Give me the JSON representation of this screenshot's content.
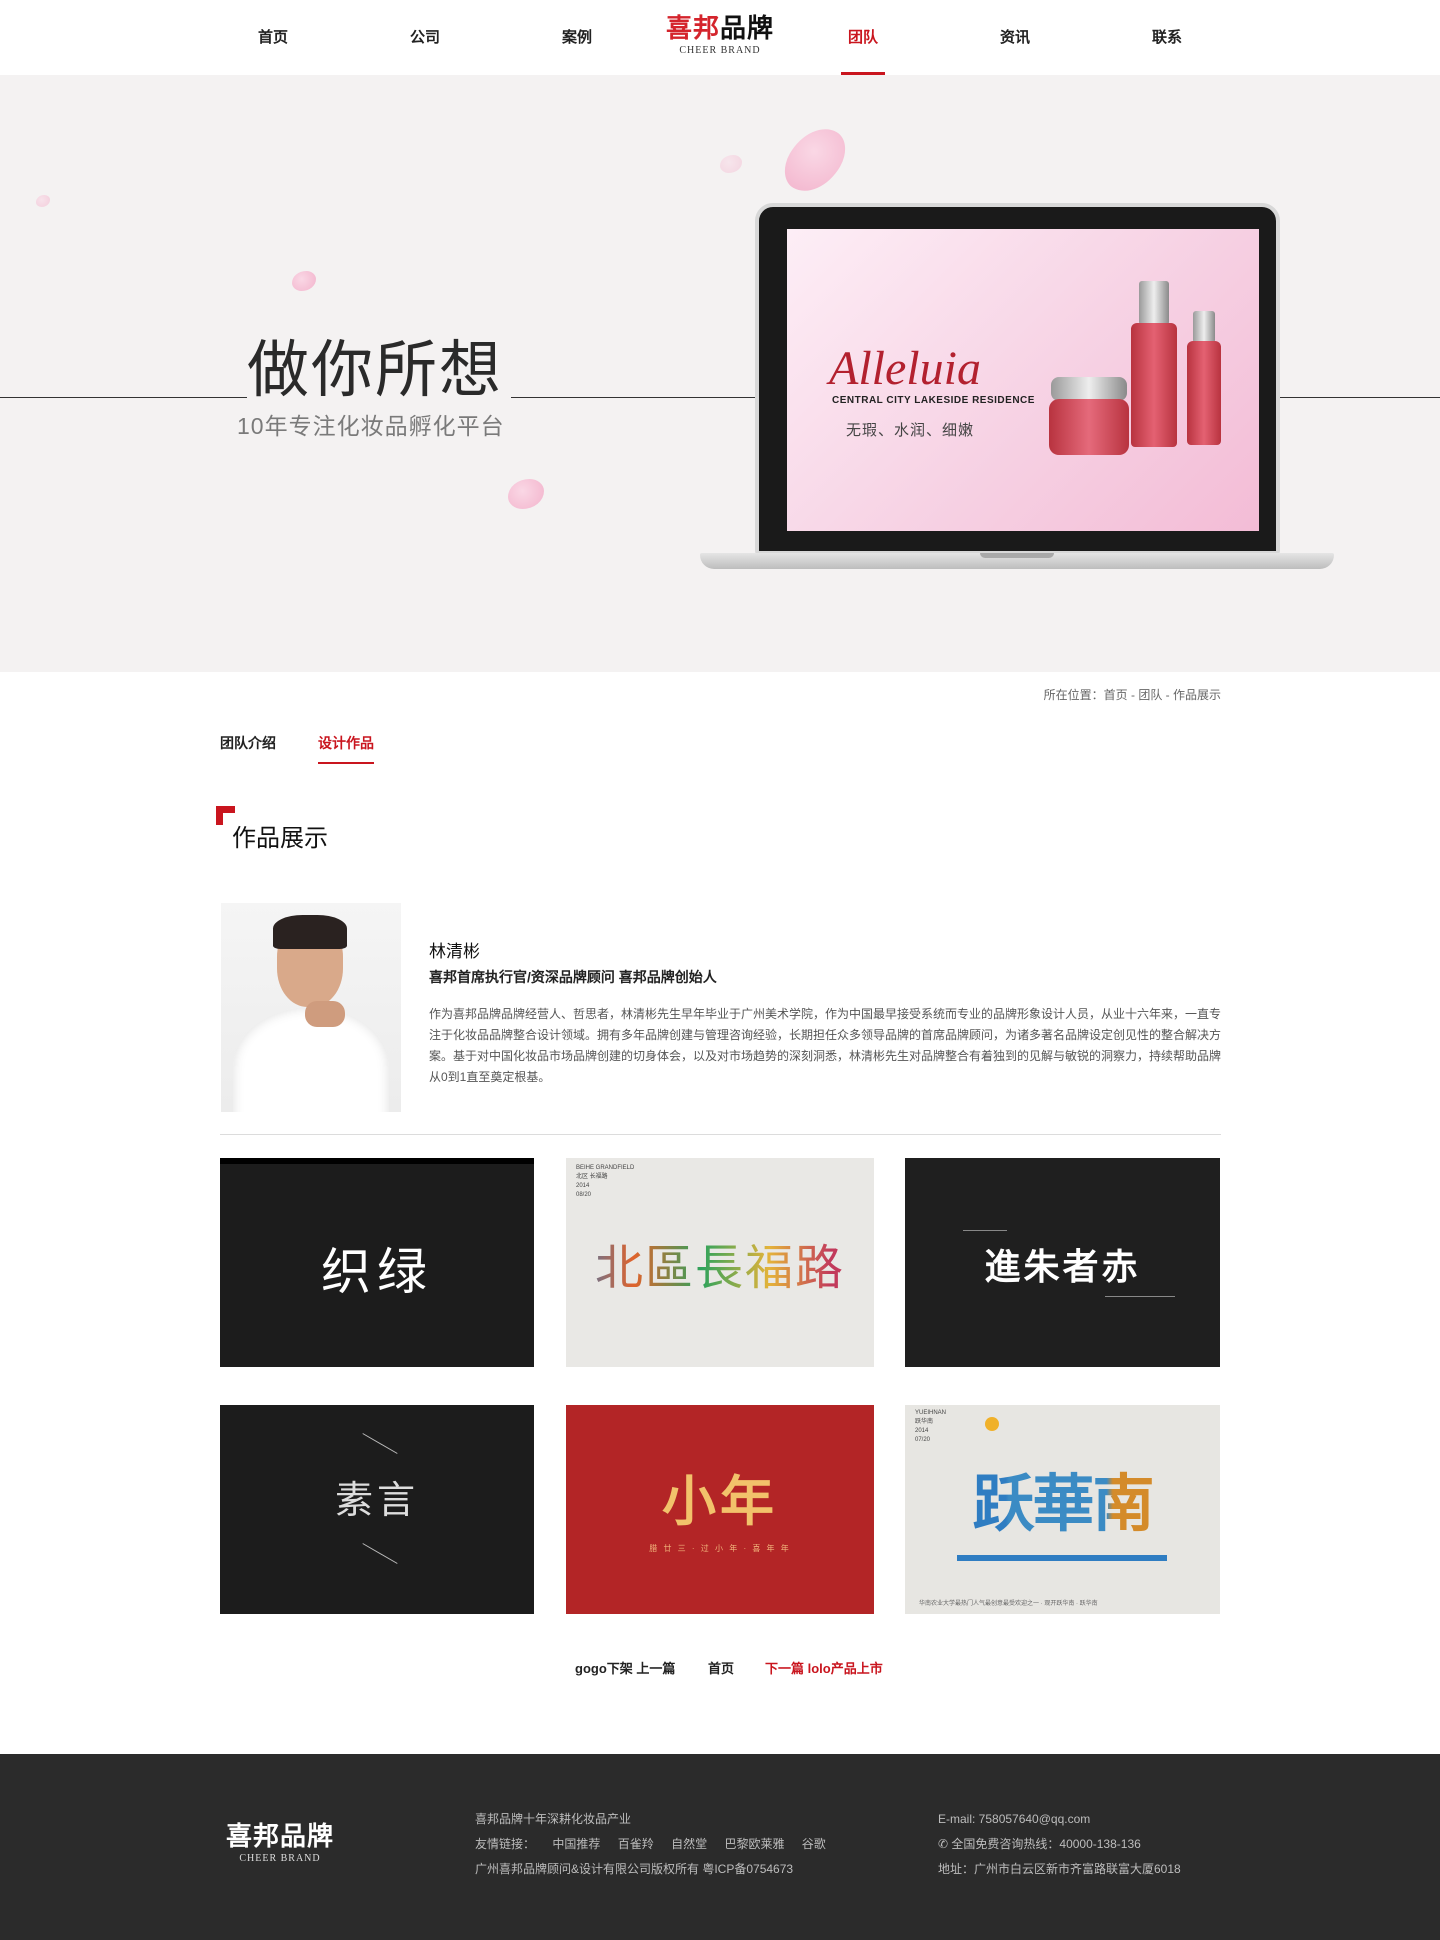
{
  "nav": {
    "items": [
      {
        "label": "首页"
      },
      {
        "label": "公司"
      },
      {
        "label": "案例"
      },
      {
        "label": "团队"
      },
      {
        "label": "资讯"
      },
      {
        "label": "联系"
      }
    ],
    "active": "团队"
  },
  "logo": {
    "cn_red": "喜邦",
    "cn_black": "品牌",
    "en": "CHEER BRAND"
  },
  "banner": {
    "title": "做你所想",
    "subtitle": "10年专注化妆品孵化平台",
    "screen_brand": "Alleluia",
    "screen_brand_sub": "CENTRAL CITY LAKESIDE RESIDENCE",
    "screen_slogan": "无瑕、水润、细嫩"
  },
  "breadcrumb": "所在位置：首页 - 团队 - 作品展示",
  "tabs": [
    {
      "label": "团队介绍",
      "active": false
    },
    {
      "label": "设计作品",
      "active": true
    }
  ],
  "section": {
    "title": "作品展示"
  },
  "profile": {
    "name": "林清彬",
    "role": "喜邦首席执行官/资深品牌顾问  喜邦品牌创始人",
    "description": "作为喜邦品牌品牌经营人、哲思者，林清彬先生早年毕业于广州美术学院，作为中国最早接受系统而专业的品牌形象设计人员，从业十六年来，一直专注于化妆品品牌整合设计领域。拥有多年品牌创建与管理咨询经验，长期担任众多领导品牌的首席品牌顾问，为诸多著名品牌设定创见性的整合解决方案。基于对中国化妆品市场品牌创建的切身体会，以及对市场趋势的深刻洞悉，林清彬先生对品牌整合有着独到的见解与敏锐的洞察力，持续帮助品牌从0到1直至奠定根基。"
  },
  "works": [
    {
      "label": "织绿",
      "text_color": "#ffffff",
      "bg": "#1c1c1c"
    },
    {
      "label": "北區長福路",
      "text_color": "#333333",
      "bg": "#e9e8e5",
      "corner": "BEIHE GRANDFIELD\n北区 长福路\n2014\n08/20"
    },
    {
      "label": "進朱者赤",
      "text_color": "#ffffff",
      "bg": "#1f1f1f"
    },
    {
      "label": "素言",
      "text_color": "#dddddd",
      "bg": "#1c1c1c"
    },
    {
      "label": "小年",
      "text_color": "#f2c26b",
      "bg": "#b32526",
      "sub": "腊 廿 三 · 过 小 年 · 喜 年 年"
    },
    {
      "label": "跃華南",
      "text_color": "#2f7dc2",
      "bg": "#e7e6e2",
      "corner": "YUEIHNAN\n跃华南\n2014\n07/20",
      "bottom": "华南农业大学最热门人气最创意最受欢迎之一 · 观开跃华南 · 跃华南"
    }
  ],
  "pager": {
    "prev": "gogo下架  上一篇",
    "home": "首页",
    "next": "下一篇  lolo产品上市"
  },
  "footer": {
    "line1": "喜邦品牌十年深耕化妆品产业",
    "links_label": "友情链接：",
    "links": [
      "中国推荐",
      "百雀羚",
      "自然堂",
      "巴黎欧莱雅",
      "谷歌"
    ],
    "copyright": "广州喜邦品牌顾问&设计有限公司版权所有    粤ICP备0754673",
    "email": "E-mail: 758057640@qq.com",
    "hotline": "全国免费咨询热线：40000-138-136",
    "address": "地址：广州市白云区新市齐富路联富大厦6018"
  },
  "colors": {
    "accent": "#c9151e",
    "footer_bg": "#2b2b2b",
    "banner_bg": "#f4f2f2"
  }
}
